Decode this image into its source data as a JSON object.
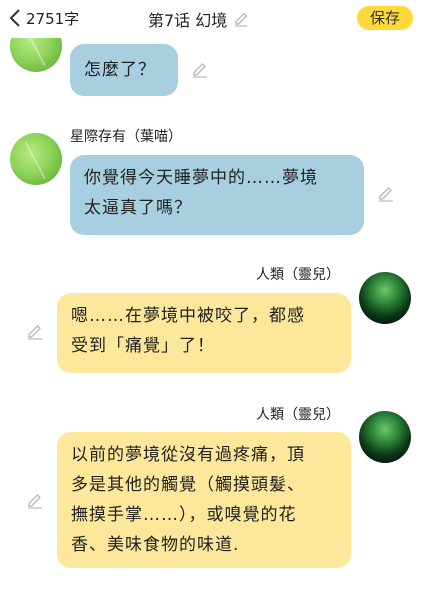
{
  "header": {
    "word_count": "2751字",
    "chapter_title": "第7话 幻境",
    "save_label": "保存"
  },
  "messages": [
    {
      "speaker": "",
      "side": "left",
      "avatar": "green-leaf",
      "text": "怎麼了？"
    },
    {
      "speaker": "星際存有（葉喵）",
      "side": "left",
      "avatar": "green-leaf",
      "lines": [
        "你覺得今天睡夢中的……夢境",
        "太逼真了嗎？"
      ]
    },
    {
      "speaker": "人類（靈兒）",
      "side": "right",
      "avatar": "dark-orb",
      "lines": [
        "嗯……在夢境中被咬了，都感",
        "受到「痛覺」了！"
      ]
    },
    {
      "speaker": "人類（靈兒）",
      "side": "right",
      "avatar": "dark-orb",
      "lines": [
        "以前的夢境從沒有過疼痛，頂",
        "多是其他的觸覺（觸摸頭髮、",
        "撫摸手掌……），或嗅覺的花",
        "香、美味食物的味道."
      ]
    }
  ],
  "colors": {
    "save_button": "#ffd93b",
    "bubble_left": "#a8cfe0",
    "bubble_right": "#fde79b"
  }
}
